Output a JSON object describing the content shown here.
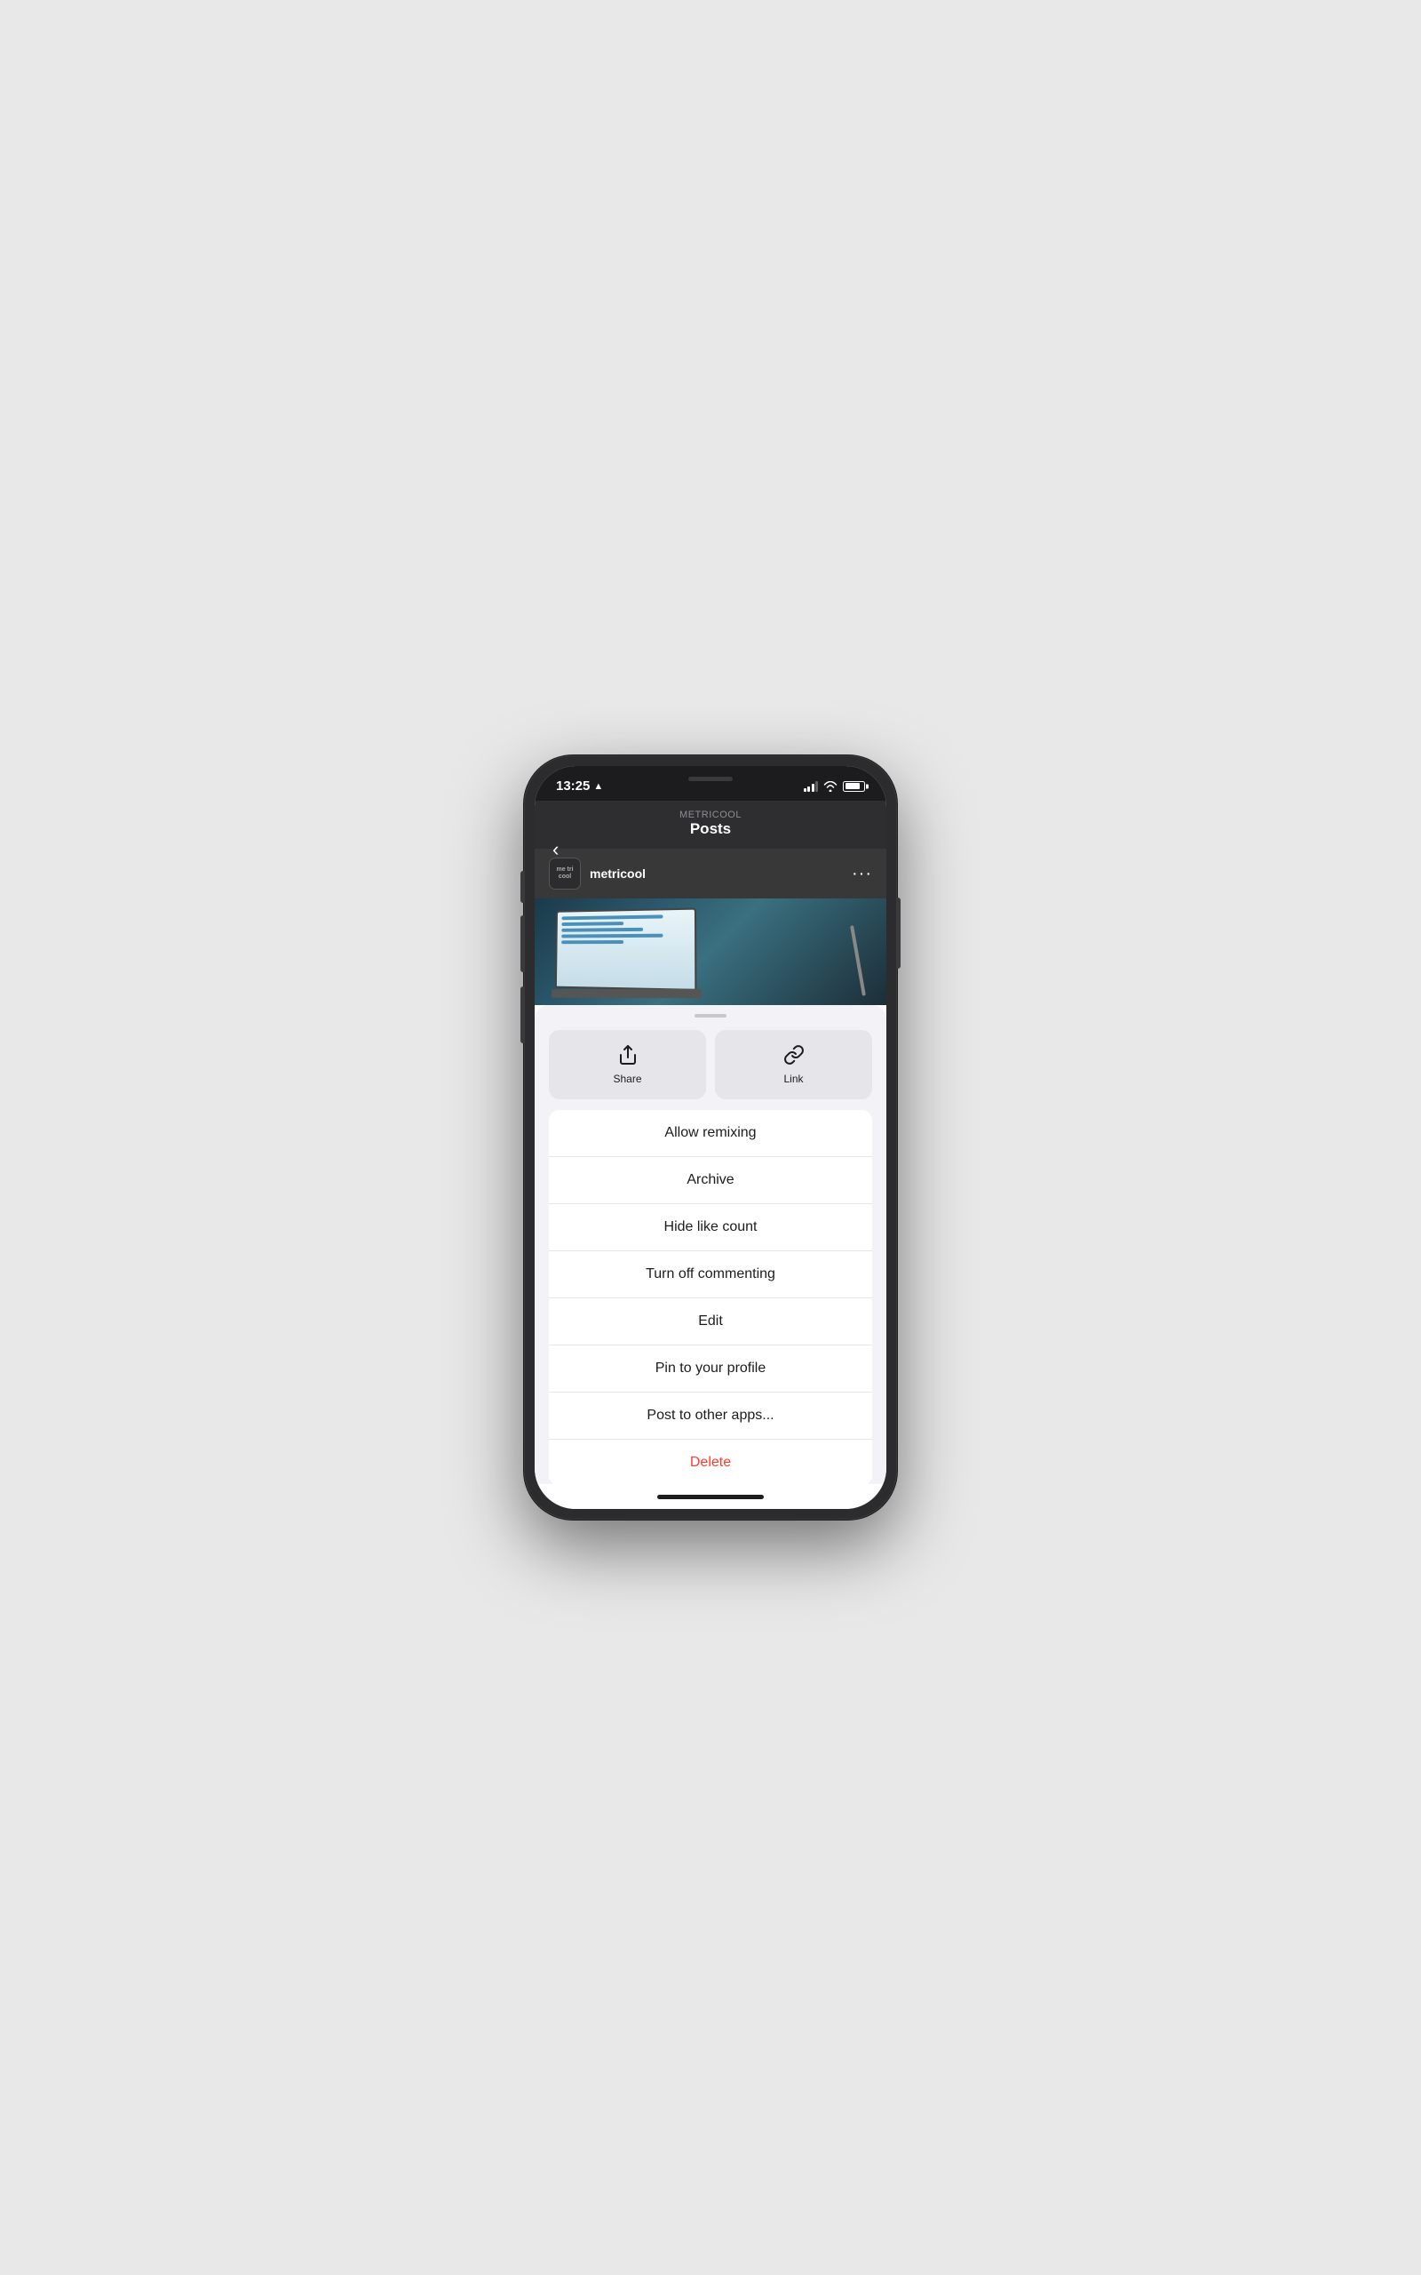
{
  "status": {
    "time": "13:25",
    "location_arrow": "➤"
  },
  "header": {
    "app_name": "METRICOOL",
    "title": "Posts",
    "back_label": "‹"
  },
  "post": {
    "username": "metricool",
    "avatar_text": "me\ntri\ncool",
    "more_dots": "···"
  },
  "sheet": {
    "action_share_label": "Share",
    "action_link_label": "Link"
  },
  "menu_items": [
    {
      "id": "allow-remixing",
      "label": "Allow remixing",
      "style": "normal"
    },
    {
      "id": "archive",
      "label": "Archive",
      "style": "normal"
    },
    {
      "id": "hide-like-count",
      "label": "Hide like count",
      "style": "normal"
    },
    {
      "id": "turn-off-commenting",
      "label": "Turn off commenting",
      "style": "normal"
    },
    {
      "id": "edit",
      "label": "Edit",
      "style": "normal"
    },
    {
      "id": "pin-to-profile",
      "label": "Pin to your profile",
      "style": "normal"
    },
    {
      "id": "post-to-other-apps",
      "label": "Post to other apps...",
      "style": "normal"
    },
    {
      "id": "delete",
      "label": "Delete",
      "style": "delete"
    }
  ]
}
